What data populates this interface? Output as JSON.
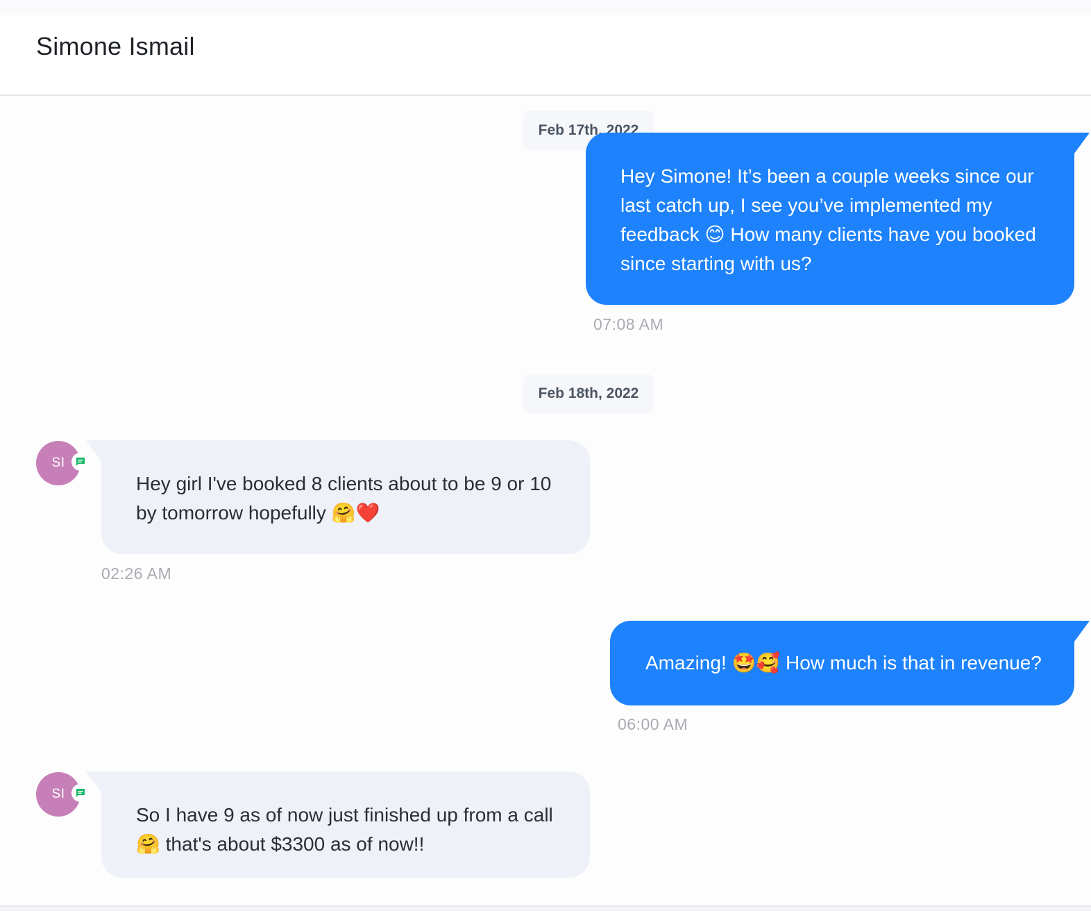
{
  "header": {
    "title": "Simone Ismail"
  },
  "contact": {
    "initials": "SI",
    "avatar_color": "#c77fb8",
    "channel_icon": "sms-chat-icon",
    "channel_color": "#1cb86a"
  },
  "colors": {
    "outgoing_bubble": "#1d82fb",
    "incoming_bubble": "#eff1f9"
  },
  "thread": {
    "date_1": "Feb 17th, 2022",
    "msg_1": {
      "direction": "outgoing",
      "text": "Hey Simone! It’s been a couple weeks since our last catch up, I see you’ve implemented my feedback 😊 How many clients have you booked since starting with us?",
      "time": "07:08 AM"
    },
    "date_2": "Feb 18th, 2022",
    "msg_2": {
      "direction": "incoming",
      "text": "Hey girl I've booked 8 clients about to be 9 or 10 by tomorrow hopefully 🤗❤️",
      "time": "02:26 AM"
    },
    "msg_3": {
      "direction": "outgoing",
      "text": "Amazing! 🤩🥰 How much is that in revenue?",
      "time": "06:00 AM"
    },
    "msg_4": {
      "direction": "incoming",
      "text": "So I have 9 as of now just finished up from a call 🤗 that's about $3300 as of now!!"
    }
  }
}
